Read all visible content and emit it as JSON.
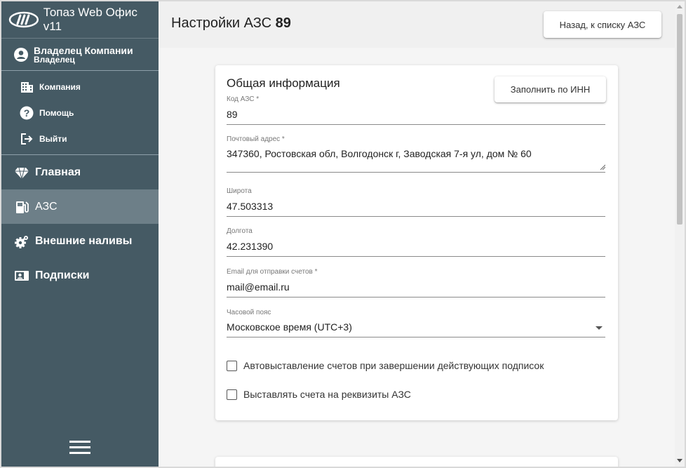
{
  "app": {
    "title": "Топаз Web Офис v11",
    "logo_icon": "topaz-logo-icon"
  },
  "user": {
    "name": "Владелец Компании",
    "role": "Владелец",
    "icon": "user-avatar-icon"
  },
  "sub_menu": [
    {
      "label": "Компания",
      "icon": "building-icon"
    },
    {
      "label": "Помощь",
      "icon": "help-icon"
    },
    {
      "label": "Выйти",
      "icon": "logout-icon"
    }
  ],
  "nav": [
    {
      "label": "Главная",
      "icon": "diamond-icon",
      "active": false
    },
    {
      "label": "АЗС",
      "icon": "fuel-pump-icon",
      "active": true
    },
    {
      "label": "Внешние наливы",
      "icon": "gears-icon",
      "active": false
    },
    {
      "label": "Подписки",
      "icon": "subscription-card-icon",
      "active": false
    }
  ],
  "header": {
    "title_prefix": "Настройки АЗС",
    "title_number": "89",
    "back_button": "Назад, к списку АЗС"
  },
  "form": {
    "section_title": "Общая информация",
    "fill_inn_button": "Заполнить по ИНН",
    "fields": {
      "code": {
        "label": "Код АЗС *",
        "value": "89"
      },
      "address": {
        "label": "Почтовый адрес *",
        "value": "347360, Ростовская обл, Волгодонск г, Заводская 7-я ул, дом № 60"
      },
      "latitude": {
        "label": "Широта",
        "value": "47.503313"
      },
      "longitude": {
        "label": "Долгота",
        "value": "42.231390"
      },
      "email": {
        "label": "Email для отправки счетов *",
        "value": "mail@email.ru"
      },
      "timezone": {
        "label": "Часовой пояс",
        "value": "Московское время (UTC+3)"
      }
    },
    "checkboxes": {
      "auto_invoice": {
        "label": "Автовыставление счетов при завершении действующих подписок",
        "checked": false
      },
      "station_requisites": {
        "label": "Выставлять счета на реквизиты АЗС",
        "checked": false
      }
    }
  },
  "colors": {
    "sidebar_bg": "#455a64",
    "sidebar_active": "#6d7f88",
    "content_bg": "#f5f5f5"
  }
}
